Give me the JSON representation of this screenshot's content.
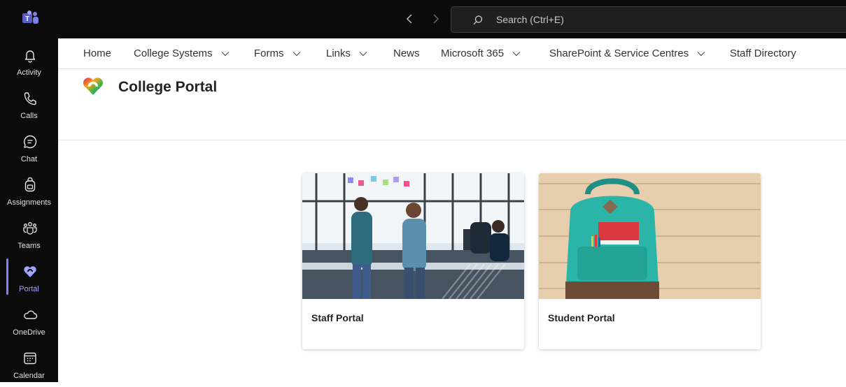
{
  "app": {
    "name": "Microsoft Teams",
    "accent": "#7f85f5"
  },
  "topbar": {
    "search_placeholder": "Search (Ctrl+E)"
  },
  "rail": {
    "items": [
      {
        "label": "Activity",
        "icon": "bell-icon"
      },
      {
        "label": "Calls",
        "icon": "phone-icon"
      },
      {
        "label": "Chat",
        "icon": "chat-icon"
      },
      {
        "label": "Assignments",
        "icon": "backpack-icon"
      },
      {
        "label": "Teams",
        "icon": "teams-icon"
      },
      {
        "label": "Portal",
        "icon": "heart-logo-icon",
        "active": true
      },
      {
        "label": "OneDrive",
        "icon": "cloud-icon"
      },
      {
        "label": "Calendar",
        "icon": "calendar-icon"
      }
    ]
  },
  "hubnav": {
    "items": [
      {
        "label": "Home",
        "dropdown": false
      },
      {
        "label": "College Systems",
        "dropdown": true
      },
      {
        "label": "Forms",
        "dropdown": true
      },
      {
        "label": "Links",
        "dropdown": true
      },
      {
        "label": "News",
        "dropdown": false
      },
      {
        "label": "Microsoft 365",
        "dropdown": true
      },
      {
        "label": "SharePoint & Service Centres",
        "dropdown": true
      },
      {
        "label": "Staff Directory",
        "dropdown": false
      }
    ]
  },
  "site": {
    "title": "College Portal"
  },
  "cards": [
    {
      "title": "Staff Portal",
      "image": "office-meeting-photo"
    },
    {
      "title": "Student Portal",
      "image": "green-backpack-photo"
    }
  ]
}
